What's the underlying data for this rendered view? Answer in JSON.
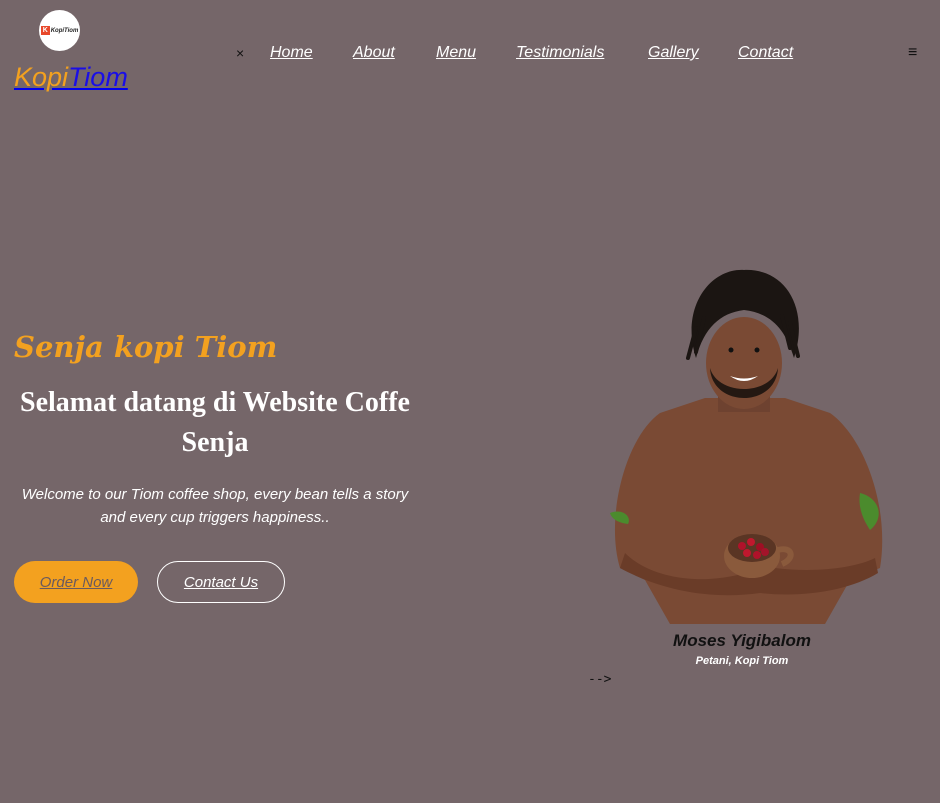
{
  "brand": {
    "logo_text": "KopiTiom",
    "logo_letter": "K",
    "name_part1": "Kopi",
    "name_part2": "Tiom"
  },
  "nav": {
    "close_icon": "×",
    "items": [
      "Home",
      "About",
      "Menu",
      "Testimonials",
      "Gallery",
      "Contact"
    ],
    "menu_icon": "≡"
  },
  "hero": {
    "script_title": "Senja kopi Tiom",
    "title": "Selamat datang di Website Coffe Senja",
    "description": "Welcome to our Tiom coffee shop, every bean tells a story and every cup triggers happiness..",
    "order_button": "Order Now",
    "contact_button": "Contact Us"
  },
  "profile": {
    "name": "Moses Yigibalom",
    "role": "Petani, Kopi Tiom",
    "arrow": "-->"
  },
  "colors": {
    "background": "#756669",
    "accent": "#f3a11f",
    "brand_blue": "#1a0ee6"
  }
}
